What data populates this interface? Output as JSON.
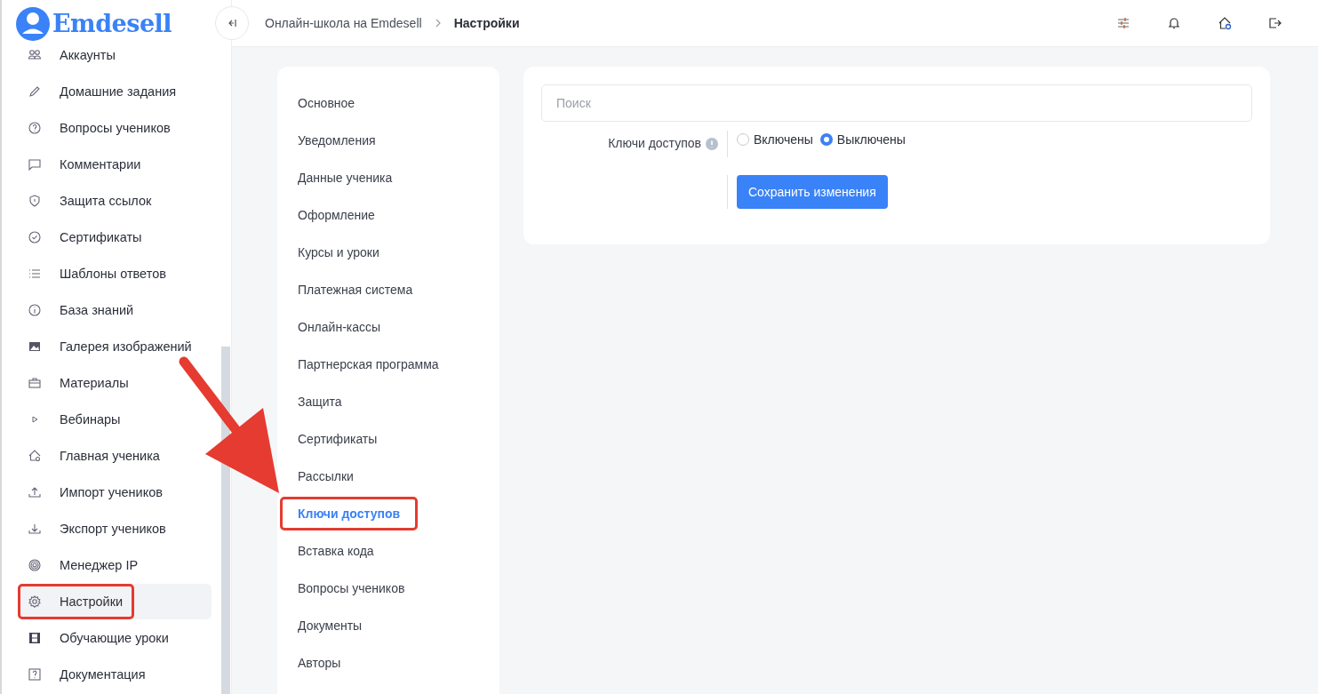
{
  "logo": {
    "text": "Emdesell"
  },
  "sidebar": {
    "items": [
      {
        "label": "Аккаунты",
        "selected": false,
        "highlighted": false
      },
      {
        "label": "Домашние задания",
        "selected": false,
        "highlighted": false
      },
      {
        "label": "Вопросы учеников",
        "selected": false,
        "highlighted": false
      },
      {
        "label": "Комментарии",
        "selected": false,
        "highlighted": false
      },
      {
        "label": "Защита ссылок",
        "selected": false,
        "highlighted": false
      },
      {
        "label": "Сертификаты",
        "selected": false,
        "highlighted": false
      },
      {
        "label": "Шаблоны ответов",
        "selected": false,
        "highlighted": false
      },
      {
        "label": "База знаний",
        "selected": false,
        "highlighted": false
      },
      {
        "label": "Галерея изображений",
        "selected": false,
        "highlighted": false
      },
      {
        "label": "Материалы",
        "selected": false,
        "highlighted": false
      },
      {
        "label": "Вебинары",
        "selected": false,
        "highlighted": false
      },
      {
        "label": "Главная ученика",
        "selected": false,
        "highlighted": false
      },
      {
        "label": "Импорт учеников",
        "selected": false,
        "highlighted": false
      },
      {
        "label": "Экспорт учеников",
        "selected": false,
        "highlighted": false
      },
      {
        "label": "Менеджер IP",
        "selected": false,
        "highlighted": false
      },
      {
        "label": "Настройки",
        "selected": true,
        "highlighted": true
      },
      {
        "label": "Обучающие уроки",
        "selected": false,
        "highlighted": false
      },
      {
        "label": "Документация",
        "selected": false,
        "highlighted": false
      }
    ]
  },
  "breadcrumb": [
    "Онлайн-школа на Emdesell",
    "Настройки"
  ],
  "settings_menu": {
    "items": [
      {
        "label": "Основное",
        "selected": false,
        "highlighted": false
      },
      {
        "label": "Уведомления",
        "selected": false,
        "highlighted": false
      },
      {
        "label": "Данные ученика",
        "selected": false,
        "highlighted": false
      },
      {
        "label": "Оформление",
        "selected": false,
        "highlighted": false
      },
      {
        "label": "Курсы и уроки",
        "selected": false,
        "highlighted": false
      },
      {
        "label": "Платежная система",
        "selected": false,
        "highlighted": false
      },
      {
        "label": "Онлайн-кассы",
        "selected": false,
        "highlighted": false
      },
      {
        "label": "Партнерская программа",
        "selected": false,
        "highlighted": false
      },
      {
        "label": "Защита",
        "selected": false,
        "highlighted": false
      },
      {
        "label": "Сертификаты",
        "selected": false,
        "highlighted": false
      },
      {
        "label": "Рассылки",
        "selected": false,
        "highlighted": false
      },
      {
        "label": "Ключи доступов",
        "selected": true,
        "highlighted": true
      },
      {
        "label": "Вставка кода",
        "selected": false,
        "highlighted": false
      },
      {
        "label": "Вопросы учеников",
        "selected": false,
        "highlighted": false
      },
      {
        "label": "Документы",
        "selected": false,
        "highlighted": false
      },
      {
        "label": "Авторы",
        "selected": false,
        "highlighted": false
      }
    ]
  },
  "panel": {
    "search": {
      "placeholder": "Поиск"
    },
    "setting": {
      "label": "Ключи доступов",
      "options": [
        {
          "label": "Включены",
          "selected": false
        },
        {
          "label": "Выключены",
          "selected": true
        }
      ]
    },
    "save_button": "Сохранить изменения"
  }
}
